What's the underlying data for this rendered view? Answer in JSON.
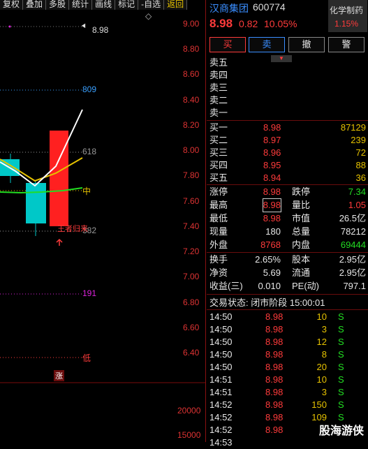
{
  "toolbar": {
    "items": [
      "复权",
      "叠加",
      "多股",
      "统计",
      "画线",
      "标记",
      "-自选",
      "返回"
    ]
  },
  "chart": {
    "price_axis": [
      "9.00",
      "8.80",
      "8.60",
      "8.40",
      "8.20",
      "8.00",
      "7.80",
      "7.60",
      "7.40",
      "7.20",
      "7.00",
      "6.80",
      "6.60",
      "6.40"
    ],
    "volume_axis": [
      "20000",
      "15000"
    ],
    "max_label": "8.98",
    "levels": [
      {
        "label": "809",
        "color": "#3aa0ff"
      },
      {
        "label": "618",
        "color": "#999999"
      },
      {
        "label": "中",
        "color": "#e6c200"
      },
      {
        "label": "382",
        "color": "#999999"
      },
      {
        "label": "191",
        "color": "#dd22dd"
      },
      {
        "label": "低",
        "color": "#ff3b3b"
      }
    ],
    "annotation": "王者归来",
    "zhang_badge": "涨",
    "diamond": "◇",
    "arrow": "◄"
  },
  "header": {
    "name": "汉商集团",
    "code": "600774",
    "sector": "化学制药",
    "sector_pct": "1.15%",
    "price": "8.98",
    "change": "0.82",
    "change_pct": "10.05%"
  },
  "actions": [
    "买",
    "卖",
    "撤",
    "警"
  ],
  "sell_book": [
    {
      "label": "卖五"
    },
    {
      "label": "卖四"
    },
    {
      "label": "卖三"
    },
    {
      "label": "卖二"
    },
    {
      "label": "卖一"
    }
  ],
  "buy_book": [
    {
      "label": "买一",
      "price": "8.98",
      "vol": "87129"
    },
    {
      "label": "买二",
      "price": "8.97",
      "vol": "239"
    },
    {
      "label": "买三",
      "price": "8.96",
      "vol": "72"
    },
    {
      "label": "买四",
      "price": "8.95",
      "vol": "88"
    },
    {
      "label": "买五",
      "price": "8.94",
      "vol": "36"
    }
  ],
  "stats": [
    {
      "l1": "涨停",
      "v1": "8.98",
      "c1": "red",
      "l2": "跌停",
      "v2": "7.34",
      "c2": "green"
    },
    {
      "l1": "最高",
      "v1": "8.98",
      "c1": "red",
      "l2": "量比",
      "v2": "1.05",
      "c2": "red"
    },
    {
      "l1": "最低",
      "v1": "8.98",
      "c1": "red",
      "l2": "市值",
      "v2": "26.5亿",
      "c2": "white"
    },
    {
      "l1": "现量",
      "v1": "180",
      "c1": "white",
      "l2": "总量",
      "v2": "78212",
      "c2": "white"
    },
    {
      "l1": "外盘",
      "v1": "8768",
      "c1": "red",
      "l2": "内盘",
      "v2": "69444",
      "c2": "green"
    },
    {
      "l1": "换手",
      "v1": "2.65%",
      "c1": "white",
      "l2": "股本",
      "v2": "2.95亿",
      "c2": "white"
    },
    {
      "l1": "净资",
      "v1": "5.69",
      "c1": "white",
      "l2": "流通",
      "v2": "2.95亿",
      "c2": "white"
    },
    {
      "l1": "收益(三)",
      "v1": "0.010",
      "c1": "white",
      "l2": "PE(动)",
      "v2": "797.1",
      "c2": "white"
    }
  ],
  "trade_status": "交易状态: 闭市阶段 15:00:01",
  "trades": [
    {
      "time": "14:50",
      "price": "8.98",
      "vol": "10",
      "side": "S"
    },
    {
      "time": "14:50",
      "price": "8.98",
      "vol": "3",
      "side": "S"
    },
    {
      "time": "14:50",
      "price": "8.98",
      "vol": "12",
      "side": "S"
    },
    {
      "time": "14:50",
      "price": "8.98",
      "vol": "8",
      "side": "S"
    },
    {
      "time": "14:50",
      "price": "8.98",
      "vol": "20",
      "side": "S"
    },
    {
      "time": "14:51",
      "price": "8.98",
      "vol": "10",
      "side": "S"
    },
    {
      "time": "14:51",
      "price": "8.98",
      "vol": "3",
      "side": "S"
    },
    {
      "time": "14:52",
      "price": "8.98",
      "vol": "150",
      "side": "S"
    },
    {
      "time": "14:52",
      "price": "8.98",
      "vol": "109",
      "side": "S"
    },
    {
      "time": "14:52",
      "price": "8.98",
      "vol": "",
      "side": ""
    },
    {
      "time": "14:53",
      "price": "",
      "vol": "",
      "side": ""
    }
  ],
  "watermark": "股海游侠"
}
